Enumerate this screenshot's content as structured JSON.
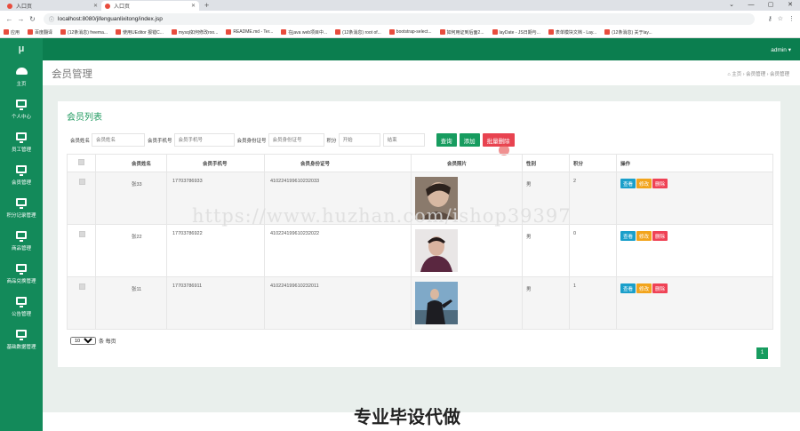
{
  "browser": {
    "tabs": [
      {
        "label": "入口页"
      },
      {
        "label": "入口页"
      }
    ],
    "new_tab": "+",
    "window_controls": [
      "⌄",
      "—",
      "▢",
      "✕"
    ],
    "url": "localhost:8080/jifenguanlixitong/index.jsp",
    "bookmarks": [
      "应用",
      "百度翻译",
      "(12条消息) freema...",
      "使用UEditor 报错C...",
      "mysql如何修改roo...",
      "README.md - Ter...",
      "在java web项目中...",
      "(12条消息) root of...",
      "bootstrap-select...",
      "如何用证到后面2...",
      "layDate - JS日期与...",
      "表单模块文档 - Lay...",
      "(12条消息) 关于lay..."
    ]
  },
  "sidebar": {
    "logo": "μ",
    "items": [
      {
        "label": "主页",
        "icon": "gauge-icon"
      },
      {
        "label": "个人中心",
        "icon": "monitor-icon"
      },
      {
        "label": "员工管理",
        "icon": "monitor-icon"
      },
      {
        "label": "会员管理",
        "icon": "monitor-icon"
      },
      {
        "label": "积分记录管理",
        "icon": "monitor-icon"
      },
      {
        "label": "商品管理",
        "icon": "monitor-icon"
      },
      {
        "label": "商品兑换管理",
        "icon": "monitor-icon"
      },
      {
        "label": "公告管理",
        "icon": "monitor-icon"
      },
      {
        "label": "基础数据管理",
        "icon": "monitor-icon"
      }
    ]
  },
  "topnav": {
    "user": "admin ▾"
  },
  "header": {
    "title": "会员管理",
    "breadcrumb": "⌂ 主页 › 会员管理 › 会员管理"
  },
  "card": {
    "title": "会员列表",
    "search": {
      "name_label": "会员姓名",
      "name_placeholder": "会员姓名",
      "phone_label": "会员手机号",
      "phone_placeholder": "会员手机号",
      "idcard_label": "会员身份证号",
      "idcard_placeholder": "会员身份证号",
      "points_label": "积分",
      "start_placeholder": "开始",
      "end_placeholder": "结束",
      "query": "查询",
      "add": "添加",
      "batch_delete": "批量删除"
    },
    "columns": [
      "会员姓名",
      "会员手机号",
      "会员身份证号",
      "会员照片",
      "性别",
      "积分",
      "操作"
    ],
    "rows": [
      {
        "name": "张33",
        "phone": "17703786933",
        "idcard": "410224199610232033",
        "gender": "男",
        "points": "2"
      },
      {
        "name": "张22",
        "phone": "17703786922",
        "idcard": "410224199610232022",
        "gender": "男",
        "points": "0"
      },
      {
        "name": "张11",
        "phone": "17703786911",
        "idcard": "410224199610232011",
        "gender": "男",
        "points": "1"
      }
    ],
    "actions": {
      "view": "查看",
      "edit": "修改",
      "delete": "删除"
    },
    "page_size": "10",
    "page_size_suffix": "条 每页",
    "current_page": "1"
  },
  "watermark": "https://www.huzhan.com/ishop39397",
  "overlay_text": "专业毕设代做",
  "colors": {
    "sidebar": "#138a5a",
    "topnav": "#0b7e4f",
    "accent": "#179c5f",
    "danger": "#e84350"
  }
}
